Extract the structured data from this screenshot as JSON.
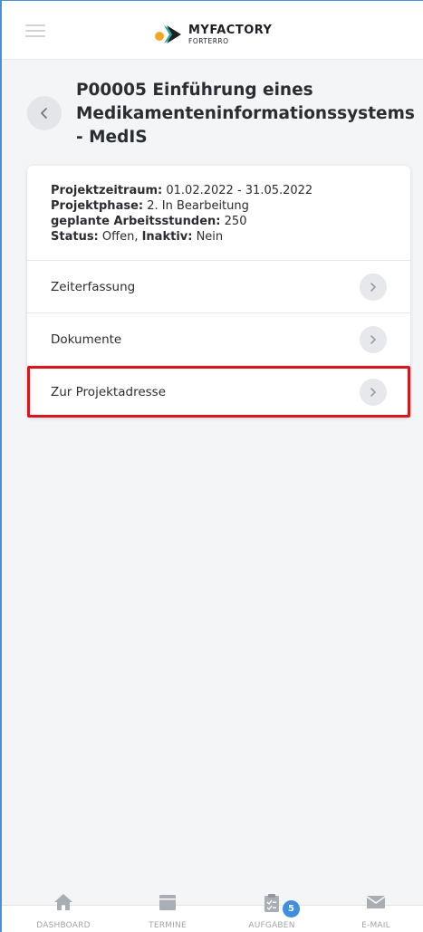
{
  "app": {
    "logo_main": "MYFACTORY",
    "logo_sub": "FORTERRO"
  },
  "colors": {
    "accent": "#3f8fdc",
    "highlight": "#d7161d",
    "logo_orange": "#f5a623",
    "logo_teal": "#2aa7a0"
  },
  "header": {
    "title": "P00005 Einführung eines Medikamenteninformationssystems - MedIS",
    "back_icon": "chevron-left-icon"
  },
  "project_info": {
    "zeitraum_label": "Projektzeitraum:",
    "zeitraum_value": " 01.02.2022 - 31.05.2022",
    "phase_label": "Projektphase:",
    "phase_value": " 2. In Bearbeitung",
    "stunden_label": "geplante Arbeitsstunden:",
    "stunden_value": " 250",
    "status_label": "Status:",
    "status_value": " Offen, ",
    "inaktiv_label": "Inaktiv:",
    "inaktiv_value": " Nein"
  },
  "menu": {
    "items": [
      {
        "label": "Zeiterfassung",
        "icon": "chevron-right-icon"
      },
      {
        "label": "Dokumente",
        "icon": "chevron-right-icon"
      },
      {
        "label": "Zur Projektadresse",
        "icon": "chevron-right-icon"
      }
    ]
  },
  "bottom_nav": {
    "tabs": [
      {
        "label": "DASHBOARD",
        "icon": "home-icon"
      },
      {
        "label": "TERMINE",
        "icon": "calendar-icon"
      },
      {
        "label": "AUFGABEN",
        "icon": "clipboard-icon",
        "badge": "5"
      },
      {
        "label": "E-MAIL",
        "icon": "mail-icon"
      }
    ]
  }
}
